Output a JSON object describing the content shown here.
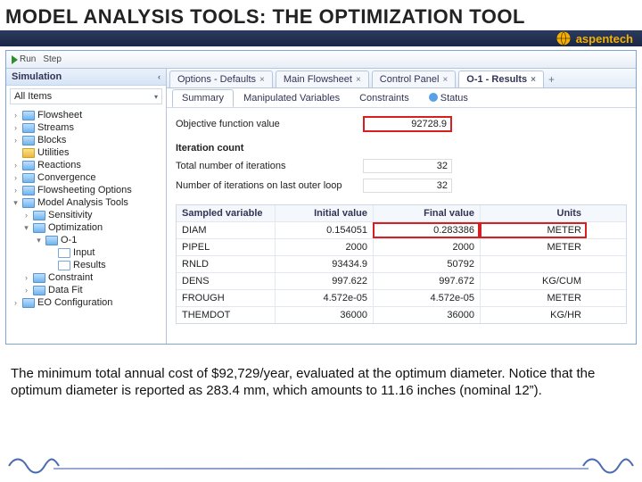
{
  "title": "MODEL ANALYSIS TOOLS: THE OPTIMIZATION TOOL",
  "logo_text": "aspentech",
  "runbar": {
    "run": "Run",
    "step": "Step"
  },
  "sidebar": {
    "heading": "Simulation",
    "all_items": "All Items",
    "tree": [
      {
        "label": "Flowsheet",
        "exp": "›",
        "icon": "folder-b",
        "indent": 0
      },
      {
        "label": "Streams",
        "exp": "›",
        "icon": "folder-b",
        "indent": 0
      },
      {
        "label": "Blocks",
        "exp": "›",
        "icon": "folder-b",
        "indent": 0
      },
      {
        "label": "Utilities",
        "exp": "",
        "icon": "folder-y",
        "indent": 0
      },
      {
        "label": "Reactions",
        "exp": "›",
        "icon": "folder-b",
        "indent": 0
      },
      {
        "label": "Convergence",
        "exp": "›",
        "icon": "folder-b",
        "indent": 0
      },
      {
        "label": "Flowsheeting Options",
        "exp": "›",
        "icon": "folder-b",
        "indent": 0
      },
      {
        "label": "Model Analysis Tools",
        "exp": "▾",
        "icon": "folder-b",
        "indent": 0
      },
      {
        "label": "Sensitivity",
        "exp": "›",
        "icon": "folder-b",
        "indent": 1
      },
      {
        "label": "Optimization",
        "exp": "▾",
        "icon": "folder-b",
        "indent": 1
      },
      {
        "label": "O-1",
        "exp": "▾",
        "icon": "folder-b",
        "indent": 2
      },
      {
        "label": "Input",
        "exp": "",
        "icon": "leaf-i",
        "indent": 3
      },
      {
        "label": "Results",
        "exp": "",
        "icon": "leaf-i",
        "indent": 3
      },
      {
        "label": "Constraint",
        "exp": "›",
        "icon": "folder-b",
        "indent": 1
      },
      {
        "label": "Data Fit",
        "exp": "›",
        "icon": "folder-b",
        "indent": 1
      },
      {
        "label": "EO Configuration",
        "exp": "›",
        "icon": "folder-b",
        "indent": 0
      }
    ]
  },
  "doc_tabs": [
    {
      "label": "Options - Defaults",
      "active": false
    },
    {
      "label": "Main Flowsheet",
      "active": false
    },
    {
      "label": "Control Panel",
      "active": false
    },
    {
      "label": "O-1 - Results",
      "active": true
    }
  ],
  "sub_tabs": [
    {
      "label": "Summary",
      "active": true,
      "status": false
    },
    {
      "label": "Manipulated Variables",
      "active": false,
      "status": false
    },
    {
      "label": "Constraints",
      "active": false,
      "status": false
    },
    {
      "label": "Status",
      "active": false,
      "status": true
    }
  ],
  "summary": {
    "obj_label": "Objective function value",
    "obj_value": "92728.9",
    "iter_heading": "Iteration count",
    "total_iter_label": "Total number of iterations",
    "total_iter_value": "32",
    "outer_iter_label": "Number of iterations on last outer loop",
    "outer_iter_value": "32"
  },
  "grid": {
    "headers": [
      "Sampled variable",
      "Initial value",
      "Final value",
      "Units"
    ],
    "rows": [
      {
        "name": "DIAM",
        "init": "0.154051",
        "final": "0.283386",
        "units": "METER",
        "hl": true
      },
      {
        "name": "PIPEL",
        "init": "2000",
        "final": "2000",
        "units": "METER",
        "hl": false
      },
      {
        "name": "RNLD",
        "init": "93434.9",
        "final": "50792",
        "units": "",
        "hl": false
      },
      {
        "name": "DENS",
        "init": "997.622",
        "final": "997.672",
        "units": "KG/CUM",
        "hl": false
      },
      {
        "name": "FROUGH",
        "init": "4.572e-05",
        "final": "4.572e-05",
        "units": "METER",
        "hl": false
      },
      {
        "name": "THEMDOT",
        "init": "36000",
        "final": "36000",
        "units": "KG/HR",
        "hl": false
      }
    ]
  },
  "footnote": "The minimum total annual cost of $92,729/year, evaluated at the optimum diameter. Notice that the optimum diameter is reported as 283.4 mm, which amounts to 11.16 inches (nominal 12”)."
}
